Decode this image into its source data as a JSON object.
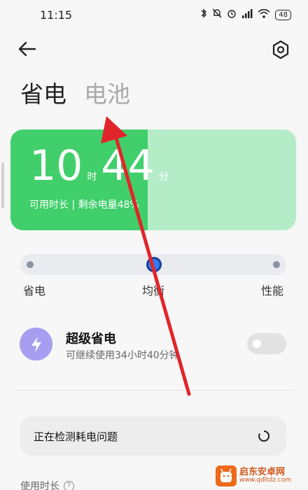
{
  "status_bar": {
    "time": "11:15",
    "battery": "48",
    "icons": [
      "bluetooth-icon",
      "bell-muted-icon",
      "alarm-icon",
      "signal-icon",
      "wifi-icon",
      "battery-icon"
    ]
  },
  "header": {
    "back_icon": "back-arrow-icon",
    "settings_icon": "settings-icon"
  },
  "tabs": [
    {
      "label": "省电",
      "active": true
    },
    {
      "label": "电池",
      "active": false
    }
  ],
  "battery_card": {
    "hours": "10",
    "hours_unit": "时",
    "minutes": "44",
    "minutes_unit": "分",
    "subtitle": "可用时长 | 剩余电量48%",
    "level_percent": 48,
    "fill_color": "#40cf6a",
    "bg_color": "#b5ecc8"
  },
  "mode_selector": {
    "options": [
      "省电",
      "均衡",
      "性能"
    ],
    "selected": "均衡",
    "accent_color": "#2f7ff4"
  },
  "super_saver": {
    "icon": "lightning-icon",
    "title": "超级省电",
    "subtitle": "可继续使用34小时40分钟",
    "enabled": false,
    "icon_color": "#a89ef1"
  },
  "detect_card": {
    "text": "正在检测耗电问题",
    "icon": "loading-spinner-icon"
  },
  "usage": {
    "label": "使用时长",
    "help_icon": "help-icon",
    "help_glyph": "?"
  },
  "annotation": {
    "arrow_color": "#e0262a"
  },
  "watermark": {
    "name": "启东安卓网",
    "url": "www.qdltdz.com"
  }
}
